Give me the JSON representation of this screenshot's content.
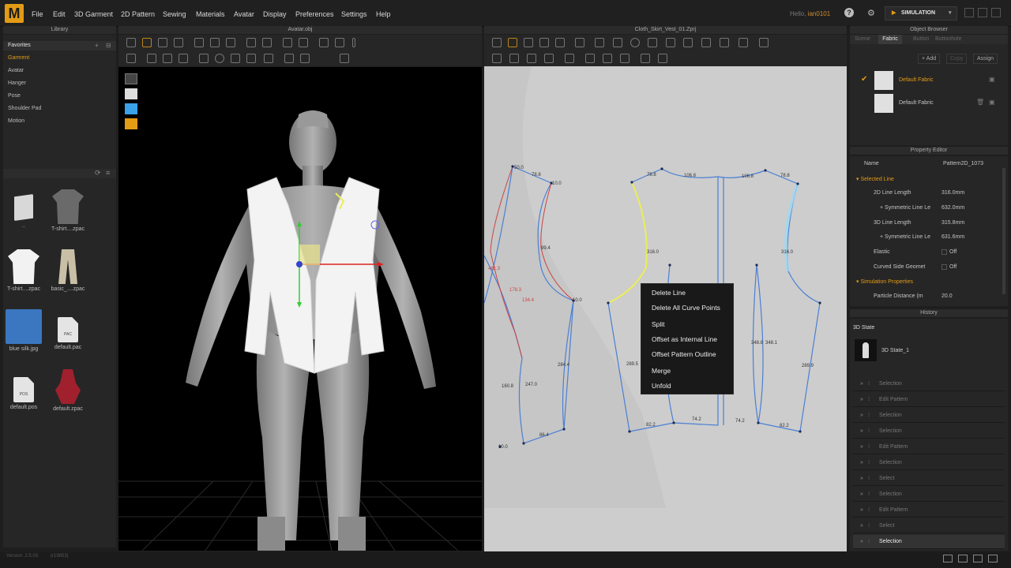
{
  "menubar": {
    "logo": "M",
    "items": [
      "File",
      "Edit",
      "3D Garment",
      "2D Pattern",
      "Sewing",
      "Materials",
      "Avatar",
      "Display",
      "Preferences",
      "Settings",
      "Help"
    ],
    "user_greeting": "Hello,",
    "user_name": "ian0101",
    "mode": "SIMULATION"
  },
  "panels": {
    "library": "Library",
    "avatar_view": "Avatar.obj",
    "pattern_view": "Cloth_Skirt_Vest_01.Zprj",
    "object_browser": "Object Browser",
    "property_editor": "Property Editor",
    "history": "History"
  },
  "library": {
    "categories": [
      "Favorites",
      "Garment",
      "Avatar",
      "Hanger",
      "Pose",
      "Shoulder Pad",
      "Motion"
    ],
    "active_category": "Garment",
    "files": [
      {
        "label": "..",
        "kind": "folder"
      },
      {
        "label": "T-shirt....zpac",
        "kind": "tshirt-dark"
      },
      {
        "label": "T-shirt....zpac",
        "kind": "tshirt-white"
      },
      {
        "label": "basic_....zpac",
        "kind": "pants"
      },
      {
        "label": "blue silk.jpg",
        "kind": "blue"
      },
      {
        "label": "default.pac",
        "kind": "file",
        "tag": "PAC"
      },
      {
        "label": "default.pos",
        "kind": "file",
        "tag": "POS"
      },
      {
        "label": "default.zpac",
        "kind": "red"
      }
    ]
  },
  "object_browser": {
    "tabs": [
      "Scene",
      "Fabric",
      "Button",
      "Buttonhole"
    ],
    "active_tab": "Fabric",
    "actions": [
      "+ Add",
      "Copy",
      "Assign"
    ],
    "fabrics": [
      {
        "name": "Default Fabric",
        "selected": true
      },
      {
        "name": "Default Fabric",
        "selected": false
      }
    ]
  },
  "property_editor": {
    "name_label": "Name",
    "name_value": "Pattern2D_1073",
    "section_selected_line": "Selected Line",
    "rows": [
      {
        "label": "2D Line Length",
        "value": "316.0mm"
      },
      {
        "label": "+ Symmetric Line Le",
        "value": "632.0mm"
      },
      {
        "label": "3D Line Length",
        "value": "315.8mm"
      },
      {
        "label": "+ Symmetric Line Le",
        "value": "631.6mm"
      },
      {
        "label": "Elastic",
        "value": "Off"
      },
      {
        "label": "Curved Side Geomet",
        "value": "Off"
      }
    ],
    "section_simulation": "Simulation Properties",
    "particle_label": "Particle Distance (m",
    "particle_value": "20.0"
  },
  "history": {
    "state_section": "3D State",
    "state_item": "3D State_1",
    "items": [
      "Selection",
      "Edit Pattern",
      "Selection",
      "Selection",
      "Edit Pattern",
      "Selection",
      "Select",
      "Selection",
      "Edit Pattern",
      "Select",
      "Selection"
    ],
    "active_index": 10
  },
  "context_menu": {
    "items": [
      "Delete Line",
      "Delete All Curve Points",
      "Split",
      "Offset as Internal Line",
      "Offset Pattern Outline",
      "Merge",
      "Unfold"
    ]
  },
  "pattern_labels": [
    "50.0",
    "78.8",
    "10.0",
    "78.8",
    "106.8",
    "106.8",
    "78.8",
    "316.0",
    "316.0",
    "99.4",
    "461.3",
    "178.3",
    "134.4",
    "10.0",
    "284.4",
    "289.5",
    "348.8",
    "348.1",
    "289.9",
    "160.8",
    "247.0",
    "86.4",
    "10.0",
    "82.2",
    "74.2",
    "74.2",
    "82.2"
  ],
  "status": {
    "version": "Version: 2.5.03",
    "build": "(r19853)"
  },
  "colors": {
    "accent": "#e39b15",
    "pattern_line": "#4a7fd4",
    "selected_line": "#e9ee58",
    "panel_bg": "#262626",
    "menu_bg": "#202020"
  }
}
